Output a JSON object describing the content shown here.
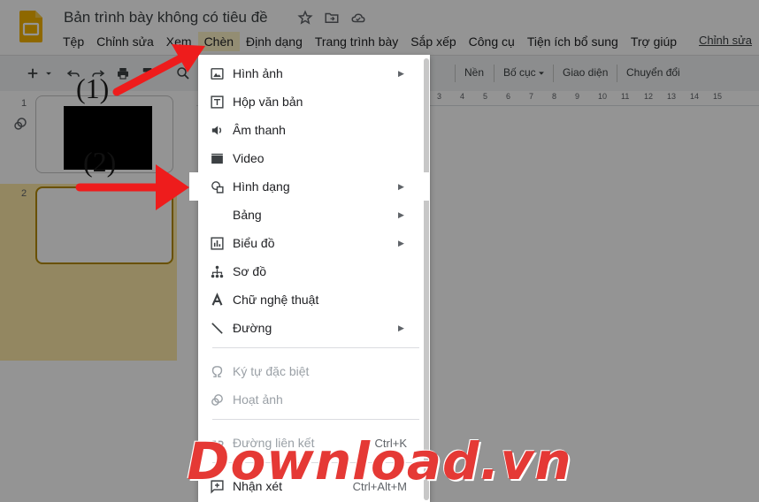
{
  "document": {
    "title": "Bản trình bày không có tiêu đề"
  },
  "menubar": {
    "items": [
      "Tệp",
      "Chỉnh sửa",
      "Xem",
      "Chèn",
      "Định dạng",
      "Trang trình bày",
      "Sắp xếp",
      "Công cụ",
      "Tiện ích bổ sung",
      "Trợ giúp"
    ],
    "active_item": "Chèn",
    "link": "Chỉnh sửa"
  },
  "toolbar": {
    "buttons": [
      "Nền",
      "Bố cục",
      "Giao diện",
      "Chuyển đổi"
    ],
    "ruler_numbers": [
      "3",
      "4",
      "5",
      "6",
      "7",
      "8",
      "9",
      "10",
      "11",
      "12",
      "13",
      "14",
      "15"
    ]
  },
  "filmstrip": {
    "slide_numbers": [
      "1",
      "2"
    ],
    "selected_slide": "2"
  },
  "insert_menu": {
    "items": [
      {
        "label": "Hình ảnh",
        "icon": "image-icon",
        "submenu": true,
        "enabled": true
      },
      {
        "label": "Hộp văn bản",
        "icon": "text-box-icon",
        "submenu": false,
        "enabled": true
      },
      {
        "label": "Âm thanh",
        "icon": "audio-icon",
        "submenu": false,
        "enabled": true
      },
      {
        "label": "Video",
        "icon": "video-icon",
        "submenu": false,
        "enabled": true
      },
      {
        "label": "Hình dạng",
        "icon": "shape-icon",
        "submenu": true,
        "enabled": true
      },
      {
        "label": "Bảng",
        "icon": "",
        "submenu": true,
        "enabled": true
      },
      {
        "label": "Biểu đồ",
        "icon": "chart-icon",
        "submenu": true,
        "enabled": true
      },
      {
        "label": "Sơ đồ",
        "icon": "diagram-icon",
        "submenu": false,
        "enabled": true
      },
      {
        "label": "Chữ nghệ thuật",
        "icon": "word-art-icon",
        "submenu": false,
        "enabled": true
      },
      {
        "label": "Đường",
        "icon": "line-icon",
        "submenu": true,
        "enabled": true
      },
      {
        "label": "Ký tự đặc biệt",
        "icon": "omega-icon",
        "submenu": false,
        "enabled": false
      },
      {
        "label": "Hoạt ảnh",
        "icon": "animation-icon",
        "submenu": false,
        "enabled": false
      },
      {
        "label": "Đường liên kết",
        "icon": "link-icon",
        "shortcut": "Ctrl+K",
        "submenu": false,
        "enabled": false
      },
      {
        "label": "Nhận xét",
        "icon": "comment-add-icon",
        "shortcut": "Ctrl+Alt+M",
        "submenu": false,
        "enabled": true
      }
    ],
    "highlighted_item": "Hình dạng"
  },
  "annotations": {
    "step1": "(1)",
    "step2": "(2)",
    "arrow_color": "#ee1c1c"
  },
  "watermark": "Download.vn",
  "colors": {
    "menu_active_bg": "#fef3c7",
    "selected_slide_bg": "#fde9a8",
    "slides_logo": "#f4b400"
  }
}
